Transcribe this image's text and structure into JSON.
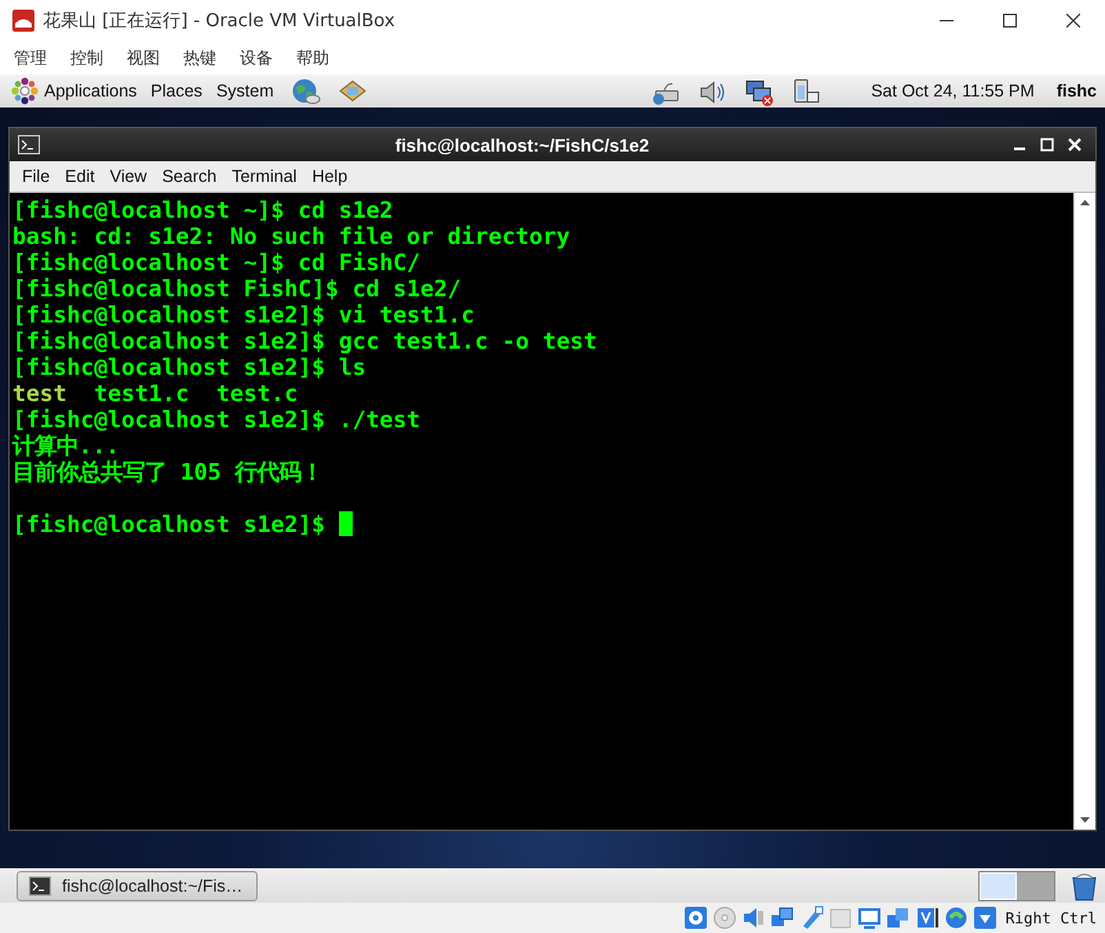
{
  "window": {
    "title": "花果山 [正在运行] - Oracle VM VirtualBox"
  },
  "menu": [
    "管理",
    "控制",
    "视图",
    "热键",
    "设备",
    "帮助"
  ],
  "top_panel": {
    "menus": [
      "Applications",
      "Places",
      "System"
    ],
    "clock": "Sat Oct 24, 11:55 PM",
    "user": "fishc"
  },
  "terminal": {
    "title": "fishc@localhost:~/FishC/s1e2",
    "menu": [
      "File",
      "Edit",
      "View",
      "Search",
      "Terminal",
      "Help"
    ],
    "cursor_visible": true,
    "lines": [
      {
        "kind": "text",
        "segments": [
          {
            "text": "[fishc@localhost ~]$ cd s1e2",
            "kind": "plain"
          }
        ]
      },
      {
        "kind": "text",
        "segments": [
          {
            "text": "bash: cd: s1e2: No such file or directory",
            "kind": "plain"
          }
        ]
      },
      {
        "kind": "text",
        "segments": [
          {
            "text": "[fishc@localhost ~]$ cd FishC/",
            "kind": "plain"
          }
        ]
      },
      {
        "kind": "text",
        "segments": [
          {
            "text": "[fishc@localhost FishC]$ cd s1e2/",
            "kind": "plain"
          }
        ]
      },
      {
        "kind": "text",
        "segments": [
          {
            "text": "[fishc@localhost s1e2]$ vi test1.c",
            "kind": "plain"
          }
        ]
      },
      {
        "kind": "text",
        "segments": [
          {
            "text": "[fishc@localhost s1e2]$ gcc test1.c -o test",
            "kind": "plain"
          }
        ]
      },
      {
        "kind": "text",
        "segments": [
          {
            "text": "[fishc@localhost s1e2]$ ls",
            "kind": "plain"
          }
        ]
      },
      {
        "kind": "text",
        "segments": [
          {
            "text": "test",
            "kind": "executable"
          },
          {
            "text": "  test1.c  test.c",
            "kind": "plain"
          }
        ]
      },
      {
        "kind": "text",
        "segments": [
          {
            "text": "[fishc@localhost s1e2]$ ./test",
            "kind": "plain"
          }
        ]
      },
      {
        "kind": "text",
        "segments": [
          {
            "text": "计算中...",
            "kind": "plain"
          }
        ]
      },
      {
        "kind": "text",
        "segments": [
          {
            "text": "目前你总共写了 105 行代码！",
            "kind": "plain"
          }
        ]
      },
      {
        "kind": "blank"
      },
      {
        "kind": "text",
        "segments": [
          {
            "text": "[fishc@localhost s1e2]$ ",
            "kind": "plain"
          }
        ]
      }
    ]
  },
  "taskbar": {
    "tasks": [
      {
        "label": "fishc@localhost:~/Fis…",
        "selected": false
      }
    ]
  },
  "workspaces": [
    {
      "selected": true
    },
    {
      "selected": false
    }
  ],
  "status_bar": {
    "host_key": "Right Ctrl"
  }
}
